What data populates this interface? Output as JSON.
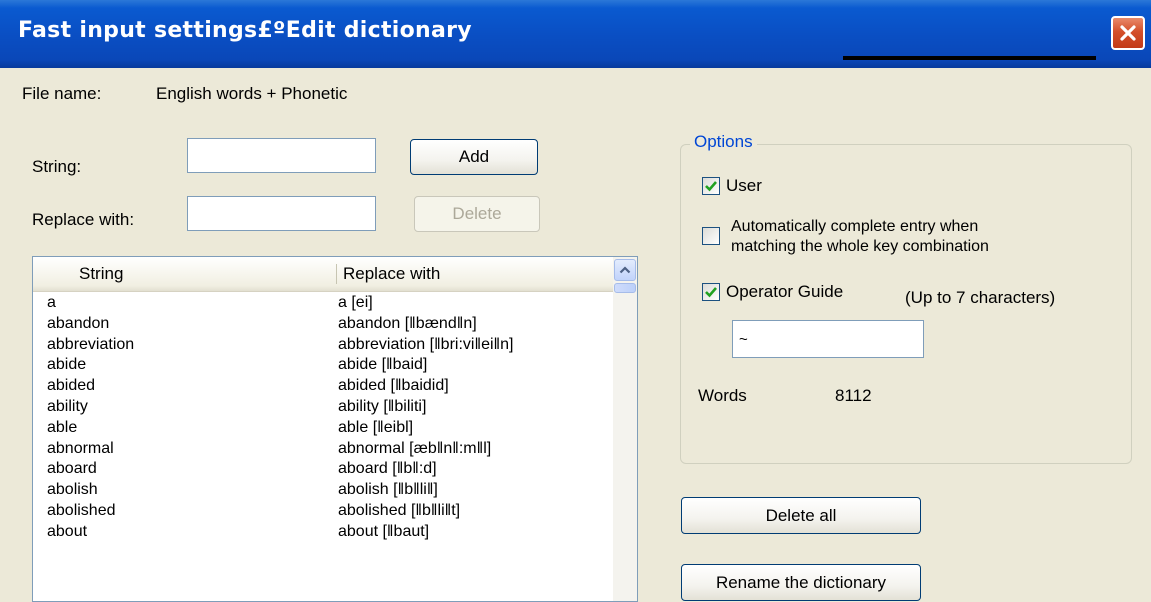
{
  "window": {
    "title": "Fast input settings£ºEdit dictionary"
  },
  "file": {
    "label": "File name:",
    "value": "English words + Phonetic"
  },
  "string_field": {
    "label": "String:",
    "value": ""
  },
  "replace_field": {
    "label": "Replace with:",
    "value": ""
  },
  "buttons": {
    "add": "Add",
    "delete": "Delete",
    "delete_all": "Delete all",
    "rename": "Rename the dictionary"
  },
  "list": {
    "columns": [
      "String",
      "Replace with"
    ],
    "rows": [
      [
        "a",
        "a [ei]"
      ],
      [
        "abandon",
        "abandon [‖bænd‖n]"
      ],
      [
        "abbreviation",
        "abbreviation [‖bri:vi‖ei‖n]"
      ],
      [
        "abide",
        "abide [‖baid]"
      ],
      [
        "abided",
        "abided [‖baidid]"
      ],
      [
        "ability",
        "ability [‖biliti]"
      ],
      [
        "able",
        "able [‖eibl]"
      ],
      [
        "abnormal",
        "abnormal [æb‖n‖:m‖l]"
      ],
      [
        "aboard",
        "aboard [‖b‖:d]"
      ],
      [
        "abolish",
        "abolish [‖b‖li‖]"
      ],
      [
        "abolished",
        "abolished [‖b‖li‖t]"
      ],
      [
        "about",
        "about [‖baut]"
      ]
    ]
  },
  "options": {
    "title": "Options",
    "user": {
      "label": "User",
      "checked": true
    },
    "auto_complete": {
      "label_line1": "Automatically complete entry when",
      "label_line2": "matching the whole key combination",
      "checked": false
    },
    "operator_guide": {
      "label": "Operator Guide",
      "checked": true,
      "note": "(Up to 7 characters)",
      "value": "~"
    },
    "words_label": "Words",
    "words_count": "8112"
  },
  "colors": {
    "titlebar": "#0a4fc4",
    "face": "#ece9d8",
    "legend": "#0046d5",
    "checkmark": "#21a121"
  }
}
